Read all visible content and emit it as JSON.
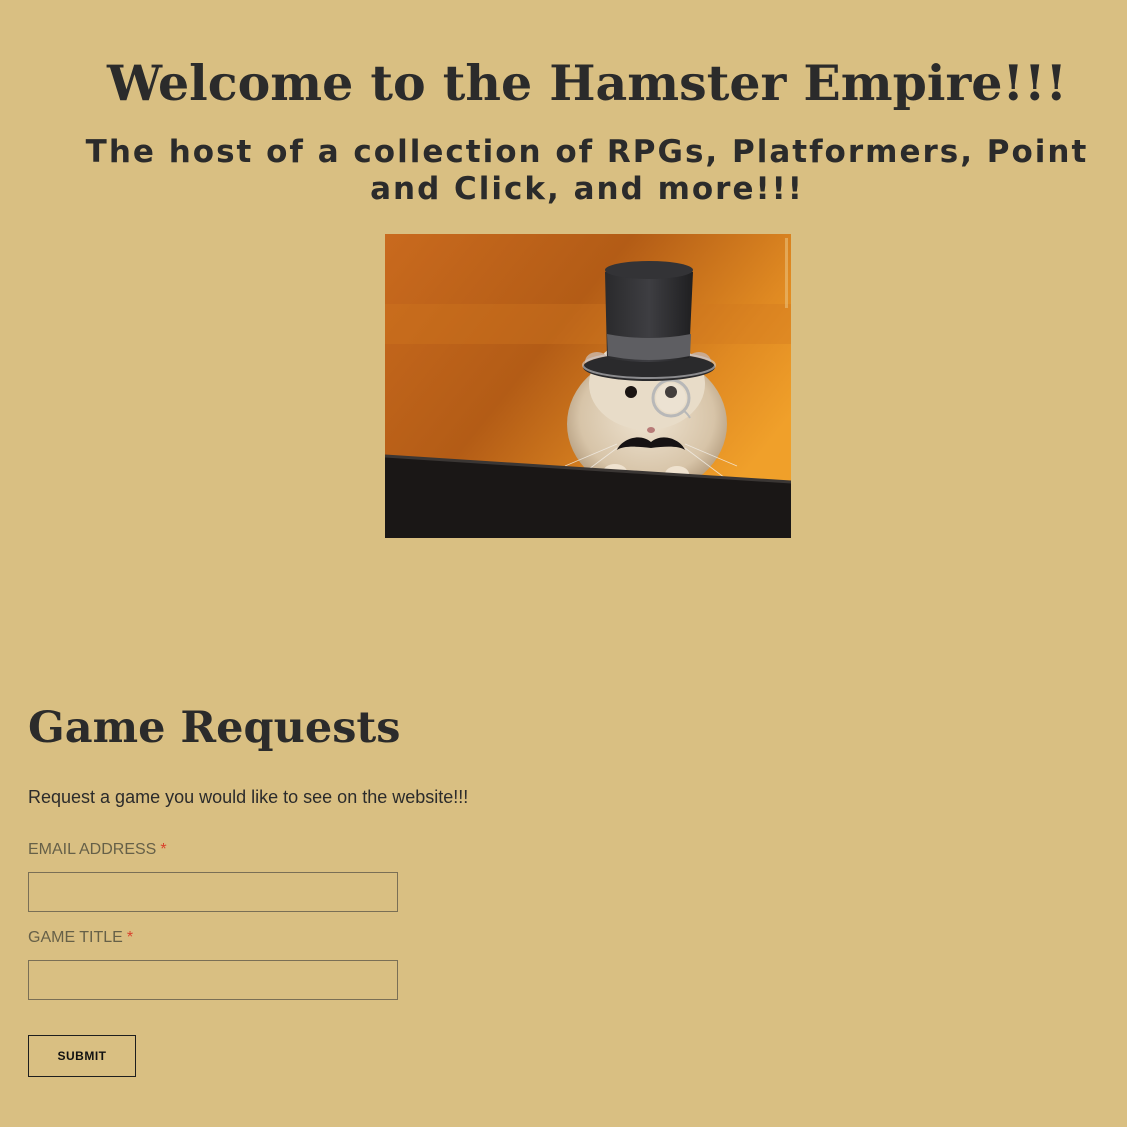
{
  "hero": {
    "title": "Welcome to the Hamster Empire!!!",
    "subtitle": "The host of a collection of RPGs, Platformers, Point and Click, and more!!!",
    "image_icon": "hamster-top-hat-monocle-mustache-image"
  },
  "requests": {
    "title": "Game Requests",
    "description": "Request a game you would like to see on the website!!!",
    "fields": [
      {
        "label": "EMAIL ADDRESS",
        "required_mark": "*",
        "value": "",
        "placeholder": ""
      },
      {
        "label": "GAME TITLE",
        "required_mark": "*",
        "value": "",
        "placeholder": ""
      }
    ],
    "submit_label": "SUBMIT"
  },
  "colors": {
    "background": "#d9bf82",
    "text": "#2b2b2b",
    "label": "#666048",
    "required": "#d9402c"
  }
}
